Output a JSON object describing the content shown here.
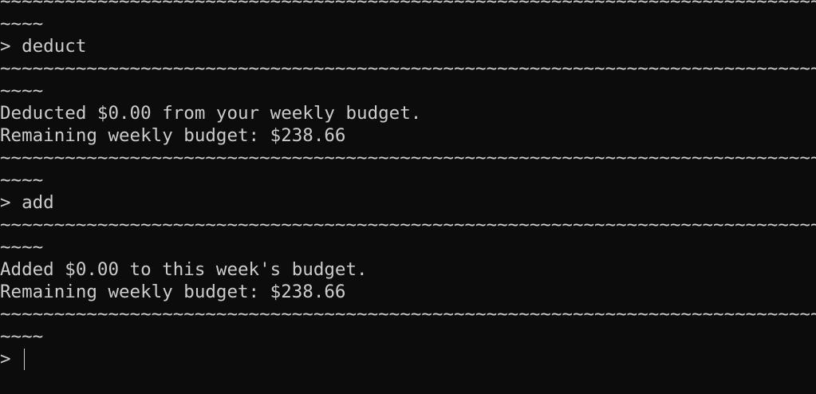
{
  "terminal": {
    "lines": [
      "~~~~~~~~~~~~~~~~~~~~~~~~~~~~~~~~~~~~~~~~~~~~~~~~~~~~~~~~~~~~~~~~~~~~~~~~~~~~~~~",
      "~~~~",
      "> deduct",
      "~~~~~~~~~~~~~~~~~~~~~~~~~~~~~~~~~~~~~~~~~~~~~~~~~~~~~~~~~~~~~~~~~~~~~~~~~~~~~~~",
      "~~~~",
      "Deducted $0.00 from your weekly budget.",
      "Remaining weekly budget: $238.66",
      "~~~~~~~~~~~~~~~~~~~~~~~~~~~~~~~~~~~~~~~~~~~~~~~~~~~~~~~~~~~~~~~~~~~~~~~~~~~~~~~",
      "~~~~",
      "> add",
      "~~~~~~~~~~~~~~~~~~~~~~~~~~~~~~~~~~~~~~~~~~~~~~~~~~~~~~~~~~~~~~~~~~~~~~~~~~~~~~~",
      "~~~~",
      "Added $0.00 to this week's budget.",
      "Remaining weekly budget: $238.66",
      "~~~~~~~~~~~~~~~~~~~~~~~~~~~~~~~~~~~~~~~~~~~~~~~~~~~~~~~~~~~~~~~~~~~~~~~~~~~~~~~",
      "~~~~"
    ],
    "prompt": "> "
  }
}
